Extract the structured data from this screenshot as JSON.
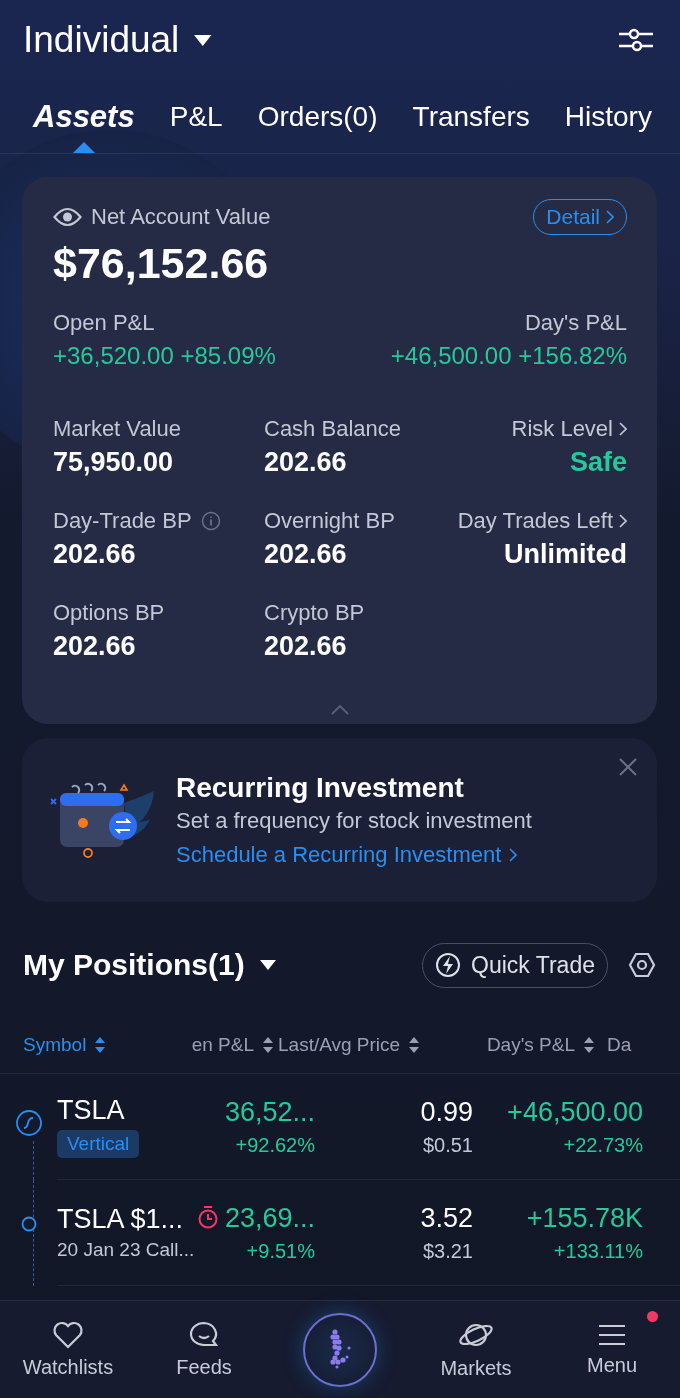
{
  "header": {
    "title": "Individual"
  },
  "tabs": [
    {
      "label": "Assets",
      "selected": true
    },
    {
      "label": "P&L",
      "selected": false
    },
    {
      "label": "Orders(0)",
      "selected": false
    },
    {
      "label": "Transfers",
      "selected": false
    },
    {
      "label": "History",
      "selected": false
    }
  ],
  "account": {
    "label": "Net Account Value",
    "value": "$76,152.66",
    "detail_button": "Detail",
    "open_pnl": {
      "label": "Open P&L",
      "value": "+36,520.00 +85.09%"
    },
    "days_pnl": {
      "label": "Day's P&L",
      "value": "+46,500.00 +156.82%"
    },
    "metrics": [
      {
        "label": "Market Value",
        "value": "75,950.00",
        "kind": "plain",
        "highlight": false
      },
      {
        "label": "Cash Balance",
        "value": "202.66",
        "kind": "plain",
        "highlight": false
      },
      {
        "label": "Risk Level",
        "value": "Safe",
        "kind": "link",
        "highlight": true
      },
      {
        "label": "Day-Trade BP",
        "value": "202.66",
        "kind": "info",
        "highlight": false
      },
      {
        "label": "Overnight BP",
        "value": "202.66",
        "kind": "plain",
        "highlight": false
      },
      {
        "label": "Day Trades Left",
        "value": "Unlimited",
        "kind": "link",
        "highlight": false
      },
      {
        "label": "Options BP",
        "value": "202.66",
        "kind": "plain",
        "highlight": false
      },
      {
        "label": "Crypto BP",
        "value": "202.66",
        "kind": "plain",
        "highlight": false
      }
    ]
  },
  "banner": {
    "title": "Recurring Investment",
    "text": "Set a frequency for stock investment",
    "link": "Schedule a Recurring Investment"
  },
  "positions": {
    "title": "My Positions(1)",
    "quick_trade": "Quick Trade",
    "columns": [
      "Symbol",
      "en P&L",
      "Last/Avg Price",
      "Day's P&L",
      "Da"
    ],
    "rows": [
      {
        "kind": "strategy",
        "symbol": "TSLA",
        "tag": "Vertical",
        "open_pnl": "36,52...",
        "open_pct": "+92.62%",
        "last": "0.99",
        "avg": "$0.51",
        "days_pnl": "+46,500.00",
        "days_pct": "+22.73%"
      },
      {
        "kind": "leg",
        "symbol": "TSLA $1...",
        "subtitle": "20 Jan 23 Call...",
        "open_pnl": "23,69...",
        "open_pct": "+9.51%",
        "last": "3.52",
        "avg": "$3.21",
        "days_pnl": "+155.78K",
        "days_pct": "+133.11%"
      }
    ]
  },
  "nav": [
    {
      "kind": "tab",
      "label": "Watchlists",
      "notification": false
    },
    {
      "kind": "tab",
      "label": "Feeds",
      "notification": false
    },
    {
      "kind": "logo"
    },
    {
      "kind": "tab",
      "label": "Markets",
      "notification": false
    },
    {
      "kind": "tab",
      "label": "Menu",
      "notification": true
    }
  ]
}
